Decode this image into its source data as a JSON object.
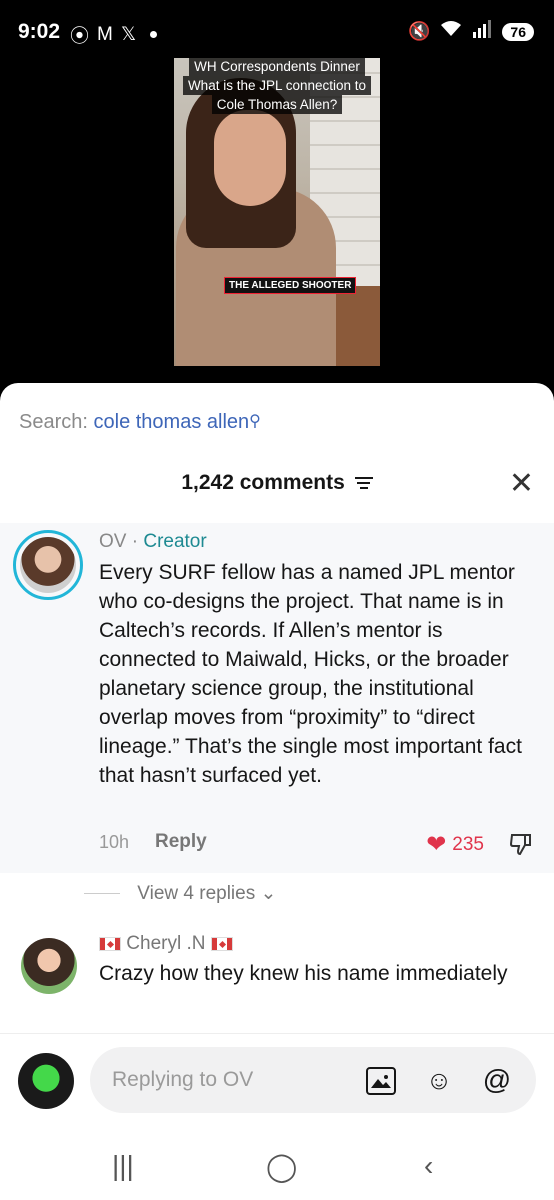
{
  "status_bar": {
    "time": "9:02",
    "icons_left": [
      "threads-icon",
      "gmail-icon",
      "x-icon"
    ],
    "icons_right": [
      "mute-icon",
      "wifi-icon",
      "signal-icon"
    ],
    "battery": "76"
  },
  "video": {
    "caption_line1": "WH Correspondents Dinner",
    "caption_line2": "What is the JPL connection to",
    "caption_line3": "Cole Thomas Allen?",
    "subtitle": "THE ALLEGED SHOOTER"
  },
  "search": {
    "prefix": "Search:",
    "query": "cole thomas allen"
  },
  "comments_header": {
    "count_label": "1,242 comments"
  },
  "comments": [
    {
      "author": "OV",
      "role": "Creator",
      "text": "Every SURF fellow has a named JPL mentor who co-designs the project. That name is in Caltech’s records. If Allen’s mentor is connected to Maiwald, Hicks, or the broader planetary science group, the institutional overlap moves from “proximity” to “direct lineage.” That’s the single most important fact that hasn’t surfaced yet.",
      "time": "10h",
      "reply_label": "Reply",
      "likes": "235",
      "view_replies": "View 4 replies"
    },
    {
      "author": "Cheryl .N",
      "text": "Crazy how they knew his name immediately"
    }
  ],
  "composer": {
    "placeholder": "Replying to OV"
  },
  "colors": {
    "accent_teal": "#1e8a92",
    "search_blue": "#3e66b8",
    "like_red": "#e0344b"
  }
}
